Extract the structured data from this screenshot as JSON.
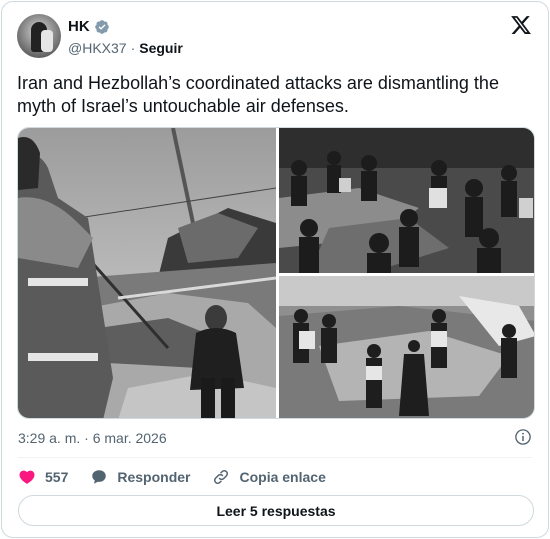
{
  "author": {
    "name": "HK",
    "handle": "@HKX37",
    "separator": "·",
    "follow_label": "Seguir"
  },
  "tweet": {
    "text": "Iran and Hezbollah’s coordinated attacks are dismantling the myth of Israel’s untouchable air defenses."
  },
  "media": {
    "photos": [
      "photo-1",
      "photo-2",
      "photo-3"
    ]
  },
  "meta": {
    "timestamp": "3:29 a. m. · 6 mar. 2026"
  },
  "actions": {
    "like_count": "557",
    "reply_label": "Responder",
    "copy_label": "Copia enlace"
  },
  "footer": {
    "read_replies_label": "Leer 5 respuestas"
  },
  "icons": [
    "verified-badge-icon",
    "x-logo-icon",
    "info-icon",
    "heart-icon",
    "reply-bubble-icon",
    "link-icon"
  ],
  "colors": {
    "text_primary": "#0f1419",
    "text_secondary": "#536471",
    "border": "#cfd9de",
    "like_red": "#f91880"
  }
}
